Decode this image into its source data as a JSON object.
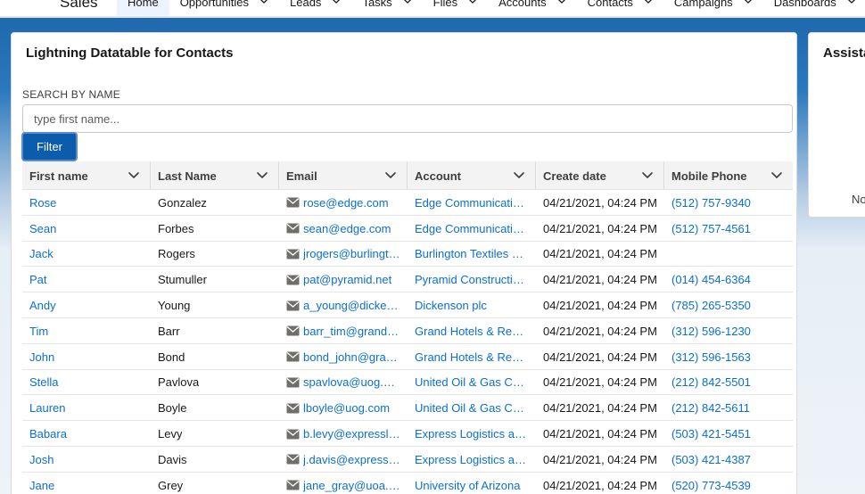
{
  "app": {
    "name": "Sales"
  },
  "nav": {
    "items": [
      {
        "label": "Home",
        "active": true,
        "has_menu": false
      },
      {
        "label": "Opportunities",
        "active": false,
        "has_menu": true
      },
      {
        "label": "Leads",
        "active": false,
        "has_menu": true
      },
      {
        "label": "Tasks",
        "active": false,
        "has_menu": true
      },
      {
        "label": "Files",
        "active": false,
        "has_menu": true
      },
      {
        "label": "Accounts",
        "active": false,
        "has_menu": true
      },
      {
        "label": "Contacts",
        "active": false,
        "has_menu": true
      },
      {
        "label": "Campaigns",
        "active": false,
        "has_menu": true
      },
      {
        "label": "Dashboards",
        "active": false,
        "has_menu": true
      }
    ]
  },
  "datatable": {
    "title": "Lightning Datatable for Contacts",
    "search_label": "SEARCH BY NAME",
    "search_placeholder": "type first name...",
    "search_value": "",
    "filter_label": "Filter",
    "columns": [
      "First name",
      "Last Name",
      "Email",
      "Account",
      "Create date",
      "Mobile Phone"
    ],
    "rows": [
      {
        "first_name": "Rose",
        "last_name": "Gonzalez",
        "email": "rose@edge.com",
        "account": "Edge Communications",
        "create_date": "04/21/2021, 04:24 PM",
        "mobile_phone": "(512) 757-9340"
      },
      {
        "first_name": "Sean",
        "last_name": "Forbes",
        "email": "sean@edge.com",
        "account": "Edge Communications",
        "create_date": "04/21/2021, 04:24 PM",
        "mobile_phone": "(512) 757-4561"
      },
      {
        "first_name": "Jack",
        "last_name": "Rogers",
        "email": "jrogers@burlington.com",
        "account": "Burlington Textiles Corp",
        "create_date": "04/21/2021, 04:24 PM",
        "mobile_phone": ""
      },
      {
        "first_name": "Pat",
        "last_name": "Stumuller",
        "email": "pat@pyramid.net",
        "account": "Pyramid Construction Inc.",
        "create_date": "04/21/2021, 04:24 PM",
        "mobile_phone": "(014) 454-6364"
      },
      {
        "first_name": "Andy",
        "last_name": "Young",
        "email": "a_young@dickenson.com",
        "account": "Dickenson plc",
        "create_date": "04/21/2021, 04:24 PM",
        "mobile_phone": "(785) 265-5350"
      },
      {
        "first_name": "Tim",
        "last_name": "Barr",
        "email": "barr_tim@grandhotels.com",
        "account": "Grand Hotels & Resorts Ltd",
        "create_date": "04/21/2021, 04:24 PM",
        "mobile_phone": "(312) 596-1230"
      },
      {
        "first_name": "John",
        "last_name": "Bond",
        "email": "bond_john@grandhotels.com",
        "account": "Grand Hotels & Resorts Ltd",
        "create_date": "04/21/2021, 04:24 PM",
        "mobile_phone": "(312) 596-1563"
      },
      {
        "first_name": "Stella",
        "last_name": "Pavlova",
        "email": "spavlova@uog.com",
        "account": "United Oil & Gas Corp.",
        "create_date": "04/21/2021, 04:24 PM",
        "mobile_phone": "(212) 842-5501"
      },
      {
        "first_name": "Lauren",
        "last_name": "Boyle",
        "email": "lboyle@uog.com",
        "account": "United Oil & Gas Corp.",
        "create_date": "04/21/2021, 04:24 PM",
        "mobile_phone": "(212) 842-5611"
      },
      {
        "first_name": "Babara",
        "last_name": "Levy",
        "email": "b.levy@expressl&t.net",
        "account": "Express Logistics and Transport",
        "create_date": "04/21/2021, 04:24 PM",
        "mobile_phone": "(503) 421-5451"
      },
      {
        "first_name": "Josh",
        "last_name": "Davis",
        "email": "j.davis@expressl&t.net",
        "account": "Express Logistics and Transport",
        "create_date": "04/21/2021, 04:24 PM",
        "mobile_phone": "(503) 421-4387"
      },
      {
        "first_name": "Jane",
        "last_name": "Grey",
        "email": "jane_gray@uoa.edu",
        "account": "University of Arizona",
        "create_date": "04/21/2021, 04:24 PM",
        "mobile_phone": "(520) 773-4539"
      }
    ]
  },
  "assistant": {
    "title": "Assistant",
    "text": "Nothing needs your attention right now."
  },
  "colors": {
    "brand": "#0b5cab",
    "link": "#0b6fcf",
    "nav_active": "#0176d3"
  },
  "icons": {
    "app_launcher": "grid-icon",
    "menu": "chevron-down-icon",
    "email": "envelope-icon"
  }
}
